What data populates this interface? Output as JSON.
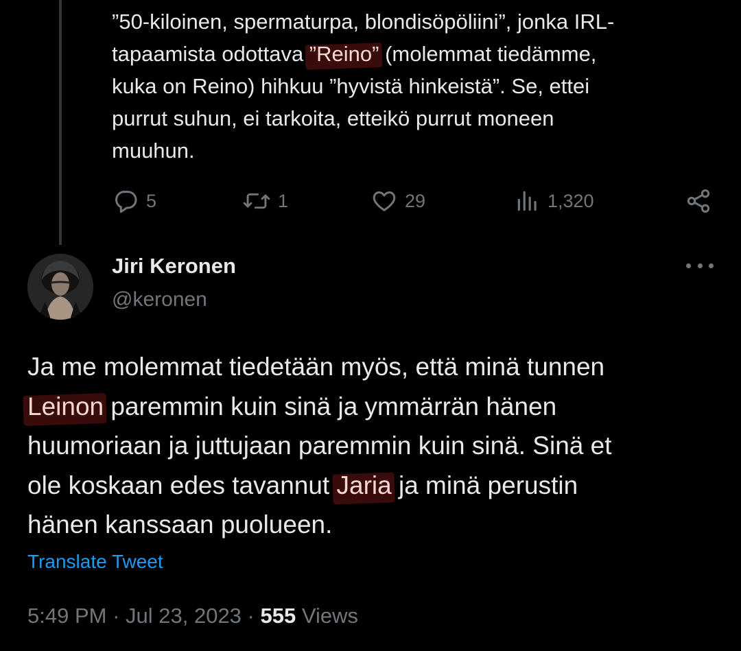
{
  "previous_tweet": {
    "text_lines": [
      "”50-kiloinen, spermaturpa, blondisöpöliini”, jonka IRL-",
      [
        "tapaamista odottava ",
        "”Reino”",
        " (molemmat tiedämme,"
      ],
      "kuka on Reino) hihkuu ”hyvistä hinkeistä”. Se, ettei",
      "purrut suhun, ei tarkoita, etteikö purrut moneen",
      "muuhun."
    ],
    "line1": "”50-kiloinen, spermaturpa, blondisöpöliini”, jonka IRL-",
    "line2_pre": "tapaamista odottava ",
    "line2_highlight": "”Reino”",
    "line2_post": " (molemmat tiedämme,",
    "line3": "kuka on Reino) hihkuu ”hyvistä hinkeistä”. Se, ettei",
    "line4": "purrut suhun, ei tarkoita, etteikö purrut moneen",
    "line5": "muuhun.",
    "actions": {
      "replies": "5",
      "retweets": "1",
      "likes": "29",
      "views": "1,320"
    }
  },
  "tweet": {
    "author_name": "Jiri Keronen",
    "author_handle": "@keronen",
    "line1": "Ja me molemmat tiedetään myös, että minä tunnen",
    "line2_highlight": "Leinon",
    "line2_post": " paremmin kuin sinä ja ymmärrän hänen",
    "line3": "huumoriaan ja juttujaan paremmin kuin sinä. Sinä et",
    "line4_pre": "ole koskaan edes tavannut ",
    "line4_highlight": "Jaria",
    "line4_post": " ja minä perustin",
    "line5": "hänen kanssaan puolueen.",
    "translate_label": "Translate Tweet",
    "time": "5:49 PM",
    "separator": " · ",
    "date": "Jul 23, 2023",
    "views_count": "555",
    "views_label": " Views"
  },
  "icons": {
    "reply": "reply-icon",
    "retweet": "retweet-icon",
    "like": "heart-icon",
    "views": "views-bar-chart-icon",
    "share": "share-icon",
    "more": "more-dots-icon"
  },
  "colors": {
    "background": "#000000",
    "text": "#e7e9ea",
    "secondary": "#71767b",
    "link": "#1d9bf0",
    "highlight": "#961e1e"
  }
}
